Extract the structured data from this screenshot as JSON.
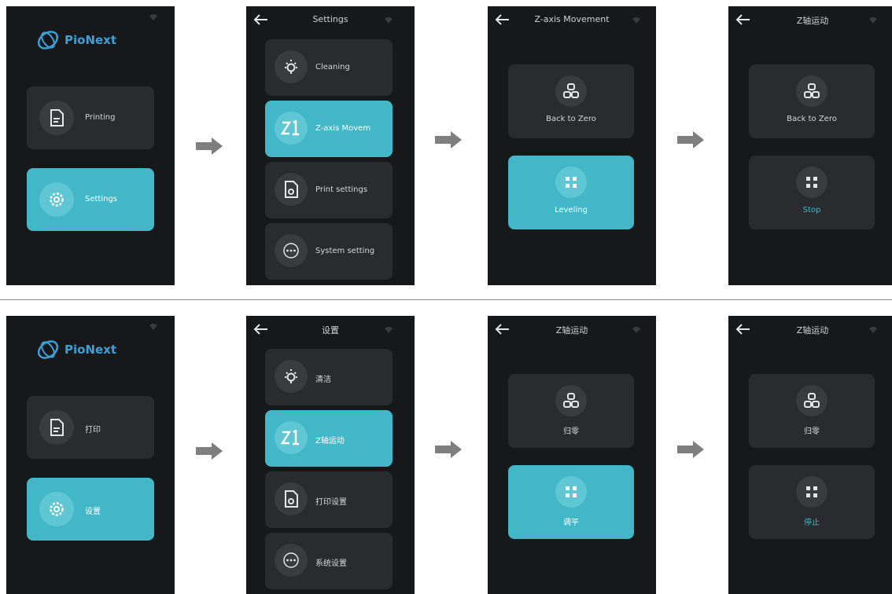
{
  "colors": {
    "screen_bg": "#17181a",
    "card_bg": "#2a2b2e",
    "accent": "#41b7c7",
    "logo": "#3aa0d8",
    "flow_arrow": "#7f7f7f"
  },
  "rows": [
    {
      "language": "en",
      "home": {
        "brand": "PioNext",
        "printing_label": "Printing",
        "settings_label": "Settings"
      },
      "settings": {
        "title": "Settings",
        "items": [
          "Cleaning",
          "Z-axis Movem",
          "Print settings",
          "System setting"
        ]
      },
      "z_axis": {
        "title": "Z-axis Movement",
        "back_to_zero": "Back to Zero",
        "leveling": "Leveling"
      },
      "z_axis_stop": {
        "title": "Z轴运动",
        "back_to_zero": "Back to Zero",
        "stop": "Stop"
      }
    },
    {
      "language": "zh",
      "home": {
        "brand": "PioNext",
        "printing_label": "打印",
        "settings_label": "设置"
      },
      "settings": {
        "title": "设置",
        "items": [
          "清洁",
          "Z轴运动",
          "打印设置",
          "系统设置"
        ]
      },
      "z_axis": {
        "title": "Z轴运动",
        "back_to_zero": "归零",
        "leveling": "调平"
      },
      "z_axis_stop": {
        "title": "Z轴运动",
        "back_to_zero": "归零",
        "stop": "停止"
      }
    }
  ]
}
